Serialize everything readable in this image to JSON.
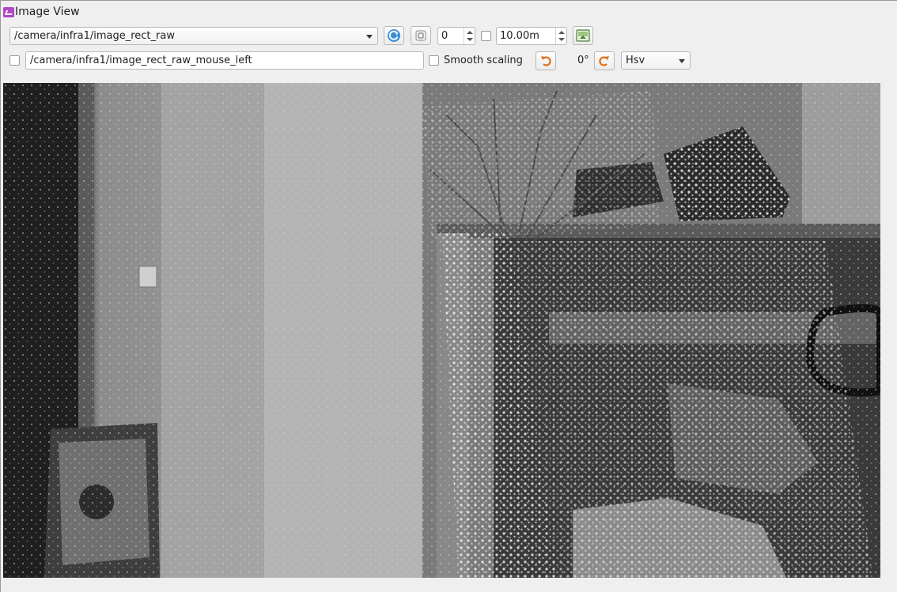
{
  "window": {
    "title": "Image View"
  },
  "toolbar": {
    "topic": "/camera/infra1/image_rect_raw",
    "spin_value": "0",
    "range_value": "10.00m",
    "mouse_topic": "/camera/infra1/image_rect_raw_mouse_left",
    "smooth_scaling_label": "Smooth scaling",
    "rotation_label": "0°",
    "colormap": "Hsv"
  },
  "icons": {
    "refresh": "refresh-icon",
    "zoom_fit": "zoom-icon",
    "save": "save-image-icon",
    "rotate_left": "rotate-left-icon",
    "rotate_right": "rotate-right-icon"
  }
}
